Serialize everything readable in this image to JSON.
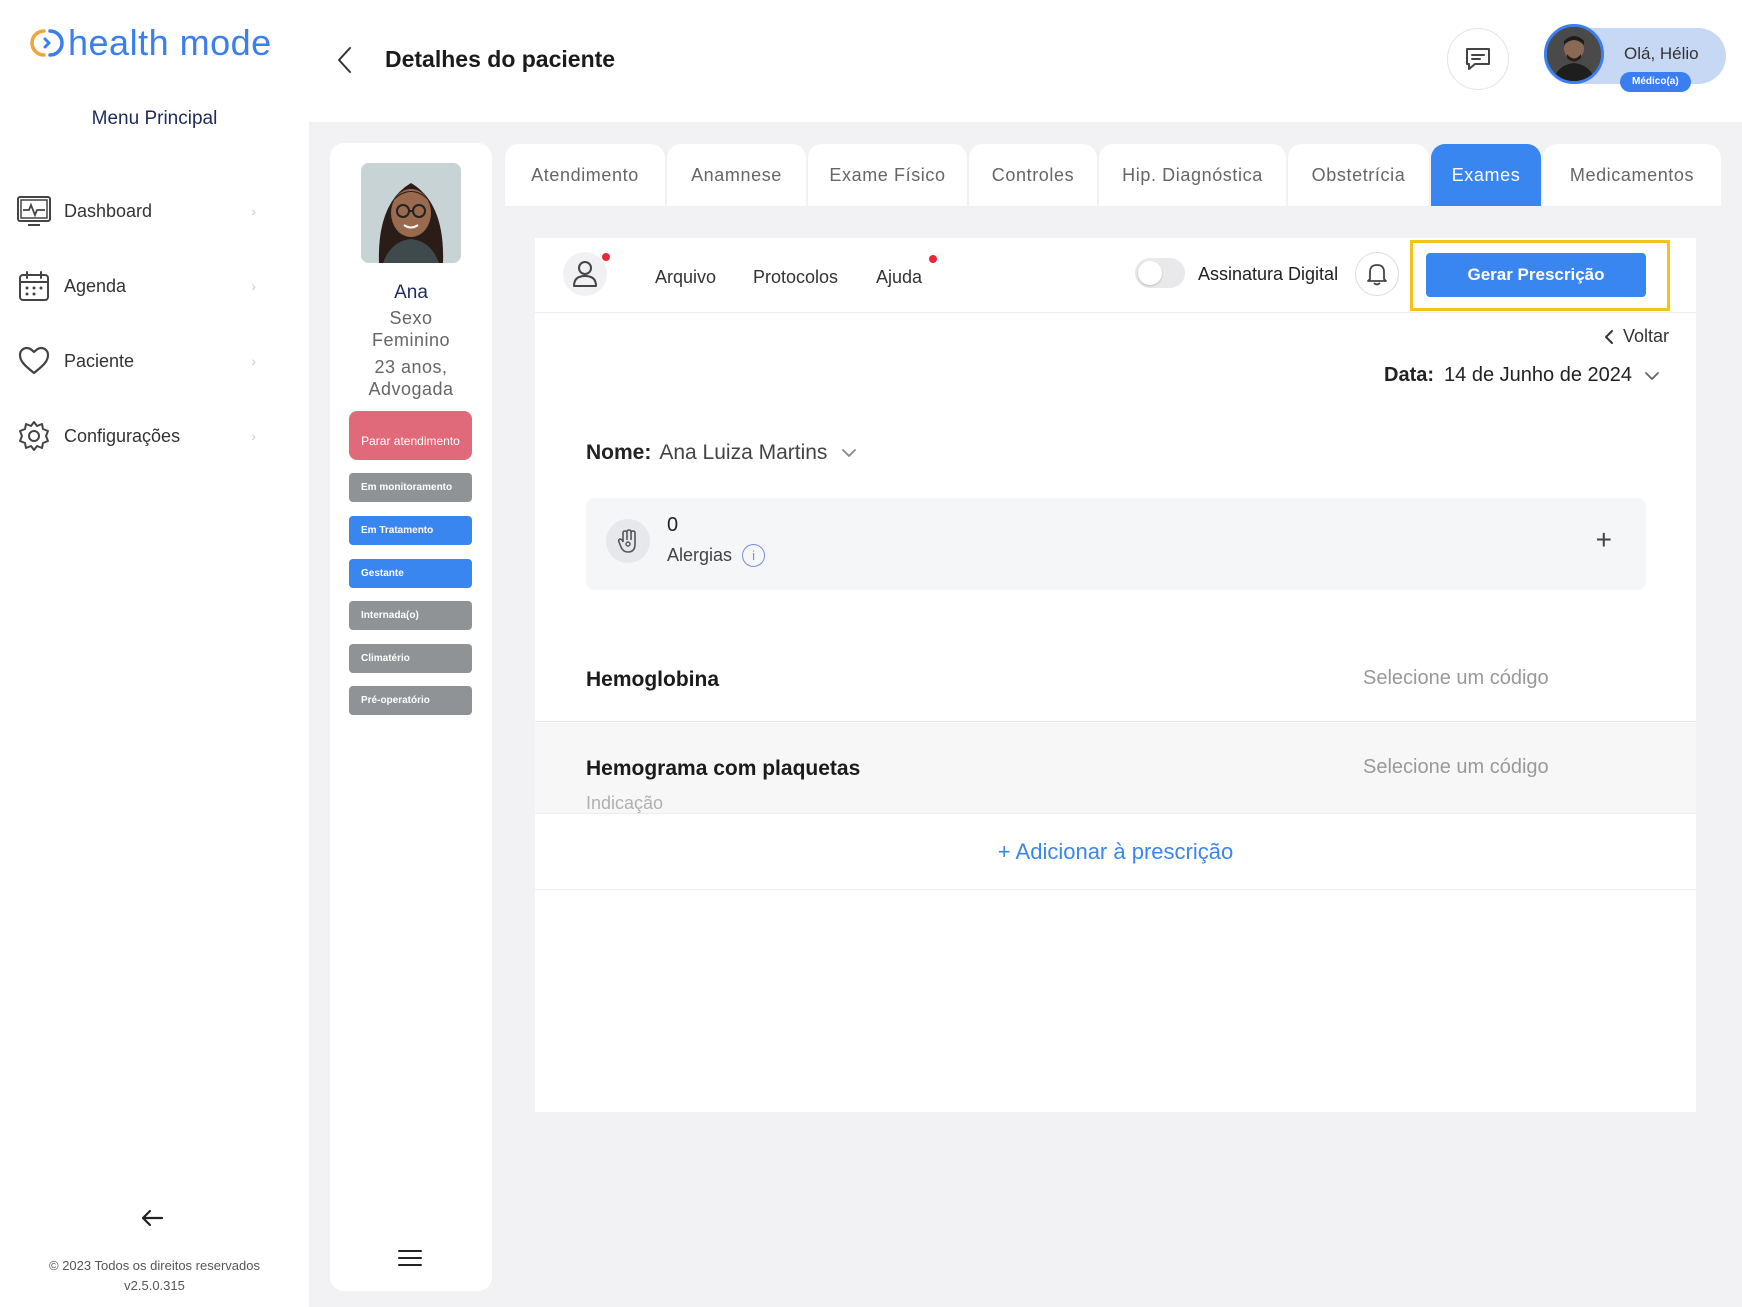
{
  "app": {
    "logo_text": "health mode",
    "menu_title": "Menu Principal"
  },
  "sidebar": {
    "items": [
      {
        "label": "Dashboard",
        "icon": "monitor-icon"
      },
      {
        "label": "Agenda",
        "icon": "calendar-icon"
      },
      {
        "label": "Paciente",
        "icon": "heart-icon"
      },
      {
        "label": "Configurações",
        "icon": "gear-icon"
      }
    ],
    "copyright": "© 2023 Todos os direitos reservados",
    "version": "v2.5.0.315"
  },
  "header": {
    "title": "Detalhes do paciente",
    "greeting": "Olá, Hélio",
    "role": "Médico(a)"
  },
  "patient": {
    "name": "Ana",
    "sex_label": "Sexo",
    "sex": "Feminino",
    "age": "23 anos,",
    "occupation": "Advogada",
    "stop_button": "Parar atendimento",
    "tags": [
      {
        "label": "Em monitoramento",
        "color": "#8f9396"
      },
      {
        "label": "Em Tratamento",
        "color": "#3a86f0"
      },
      {
        "label": "Gestante",
        "color": "#3a86f0"
      },
      {
        "label": "Internada(o)",
        "color": "#8f9396"
      },
      {
        "label": "Climatério",
        "color": "#8f9396"
      },
      {
        "label": "Pré-operatório",
        "color": "#8f9396"
      }
    ]
  },
  "tabs": [
    {
      "label": "Atendimento",
      "active": false
    },
    {
      "label": "Anamnese",
      "active": false
    },
    {
      "label": "Exame Físico",
      "active": false
    },
    {
      "label": "Controles",
      "active": false
    },
    {
      "label": "Hip. Diagnóstica",
      "active": false
    },
    {
      "label": "Obstetrícia",
      "active": false
    },
    {
      "label": "Exames",
      "active": true
    },
    {
      "label": "Medicamentos",
      "active": false
    }
  ],
  "toolbar": {
    "links": [
      "Arquivo",
      "Protocolos",
      "Ajuda"
    ],
    "signature_label": "Assinatura Digital",
    "signature_enabled": false,
    "generate_button": "Gerar Prescrição"
  },
  "content": {
    "back_label": "Voltar",
    "date_label": "Data:",
    "date_value": "14 de Junho de 2024",
    "name_label": "Nome:",
    "name_value": "Ana Luiza Martins",
    "allergy_count": "0",
    "allergy_label": "Alergias",
    "exams": [
      {
        "name": "Hemoglobina",
        "code_placeholder": "Selecione um código"
      },
      {
        "name": "Hemograma com plaquetas",
        "code_placeholder": "Selecione um código",
        "indication": "Indicação"
      }
    ],
    "add_label": "+ Adicionar à prescrição"
  },
  "colors": {
    "accent": "#3a86f0",
    "danger": "#e06a7a",
    "highlight": "#f2c418"
  }
}
